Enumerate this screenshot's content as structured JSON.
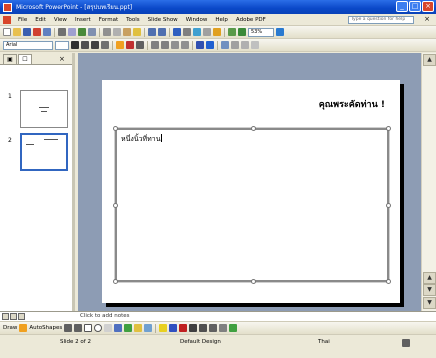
{
  "window": {
    "title": "Microsoft PowerPoint - [สรุปบทเรียน.ppt]",
    "controls": [
      "_",
      "□",
      "×"
    ]
  },
  "menu": {
    "items": [
      "File",
      "Edit",
      "View",
      "Insert",
      "Format",
      "Tools",
      "Slide Show",
      "Window",
      "Help",
      "Adobe PDF"
    ],
    "help_placeholder": "Type a question for help",
    "close": "×"
  },
  "toolbar": {
    "font_name": "Arial",
    "zoom": "53%"
  },
  "slides_pane": {
    "tabs": [
      "▣",
      "☐"
    ],
    "close": "×",
    "thumbnails": [
      {
        "number": "1"
      },
      {
        "number": "2",
        "selected": true
      }
    ]
  },
  "slide": {
    "title": "คุณพระคัดท่าน !",
    "body_text": "หนึ่งนิ้วที่ทาน"
  },
  "notes": {
    "placeholder": "Click to add notes"
  },
  "drawing": {
    "draw_label": "Draw",
    "autoshapes_label": "AutoShapes"
  },
  "status": {
    "slide_counter": "Slide 2 of 2",
    "design": "Default Design",
    "language": "Thai"
  },
  "colors": {
    "titlebar": "#0a48c8",
    "slide_area": "#8d9cb4",
    "accent_orange": "#f0a020"
  }
}
